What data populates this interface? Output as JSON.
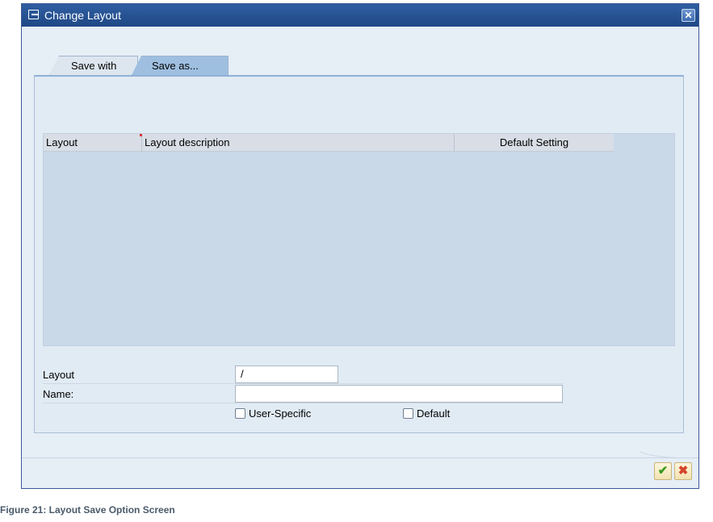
{
  "dialog": {
    "title": "Change Layout",
    "close_label": "✕"
  },
  "tabs": [
    {
      "label": "Save with",
      "active": false
    },
    {
      "label": "Save as...",
      "active": true
    }
  ],
  "grid": {
    "columns": [
      "Layout",
      "Layout description",
      "Default Setting"
    ],
    "rows": []
  },
  "form": {
    "layout_label": "Layout",
    "layout_value": "/",
    "name_label": "Name:",
    "name_value": "",
    "user_specific_label": "User-Specific",
    "user_specific_checked": false,
    "default_label": "Default",
    "default_checked": false
  },
  "footer": {
    "ok_icon": "check-icon",
    "cancel_icon": "cancel-icon"
  },
  "caption": "Figure 21: Layout Save Option Screen",
  "colors": {
    "title_bar": "#2f5fa2",
    "active_tab": "#9fbfe0",
    "panel": "#e1ebf4",
    "grid_body": "#c9d9e8"
  }
}
